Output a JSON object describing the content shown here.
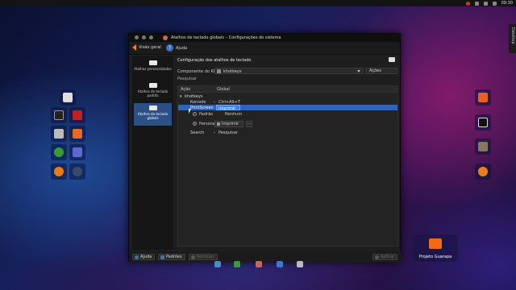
{
  "topbar": {
    "clock": "09:30"
  },
  "edge_tab": "Desktop",
  "window": {
    "title": "Atalhos de teclado globais – Configurações do sistema",
    "toolbar": {
      "back_label": "Visão geral",
      "help_label": "Ajuda"
    },
    "sidebar": [
      {
        "label": "Atalhos personalizados",
        "active": false
      },
      {
        "label": "Atalhos de teclado padrão",
        "active": false
      },
      {
        "label": "Atalhos de teclado globais",
        "active": true
      }
    ],
    "content": {
      "heading": "Configuração dos atalhos de teclado",
      "component_label": "Componente do KDE:",
      "component_value": "khotkeys",
      "actions_button": "Ações",
      "search_placeholder": "Pesquisar",
      "columns": {
        "action": "Ação",
        "global": "Global"
      },
      "tree": {
        "group": "khotkeys",
        "rows": [
          {
            "name": "Konsole",
            "shortcut": "Ctrl+Alt+T"
          },
          {
            "name": "PrintScreen",
            "shortcut": "Imprimir"
          },
          {
            "name": "Search",
            "shortcut": "Pesquisar"
          }
        ],
        "editor": {
          "default_label": "Padrão",
          "default_value": "Nenhum",
          "custom_label": "Personalizado",
          "custom_key": "Imprimir",
          "more_button": "..."
        }
      }
    },
    "bottom": {
      "help": "Ajuda",
      "defaults": "Padrões",
      "reset": "Reiniciar",
      "apply": "Aplicar"
    }
  },
  "desktop": {
    "folder_label": "Projeto Guarapa"
  },
  "colors": {
    "accent": "#2e63b8",
    "folder": "#f06a1a",
    "back_arrow": "#e38a1e"
  }
}
